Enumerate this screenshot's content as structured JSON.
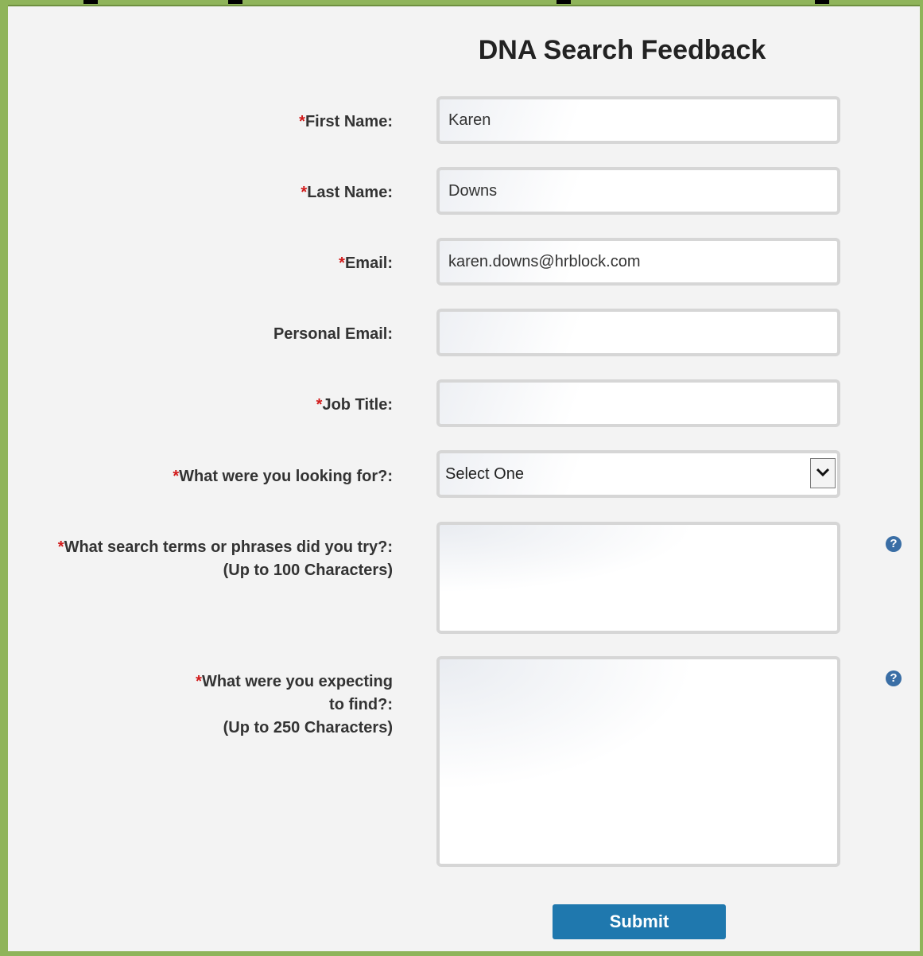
{
  "form": {
    "title": "DNA Search Feedback",
    "required_marker": "*",
    "fields": {
      "first_name": {
        "label": "First Name:",
        "value": "Karen"
      },
      "last_name": {
        "label": "Last Name:",
        "value": "Downs"
      },
      "email": {
        "label": "Email:",
        "value": "karen.downs@hrblock.com"
      },
      "personal_email": {
        "label": "Personal Email:",
        "value": ""
      },
      "job_title": {
        "label": "Job Title:",
        "value": ""
      },
      "looking_for": {
        "label": "What were you looking for?:",
        "selected": "Select One"
      },
      "search_terms": {
        "label": "What search terms or phrases did you try?:",
        "hint": "(Up to 100 Characters)",
        "value": "",
        "help_icon": "question-circle-icon"
      },
      "expecting": {
        "label_line1": "What were you expecting",
        "label_line2": "to find?:",
        "hint": "(Up to 250 Characters)",
        "value": "",
        "help_icon": "question-circle-icon"
      }
    },
    "submit_label": "Submit"
  },
  "colors": {
    "frame_border": "#8fb45a",
    "panel_background": "#f3f3f3",
    "required": "#d11a1a",
    "submit_button": "#1f78ae",
    "help_icon": "#3a6ea5"
  }
}
